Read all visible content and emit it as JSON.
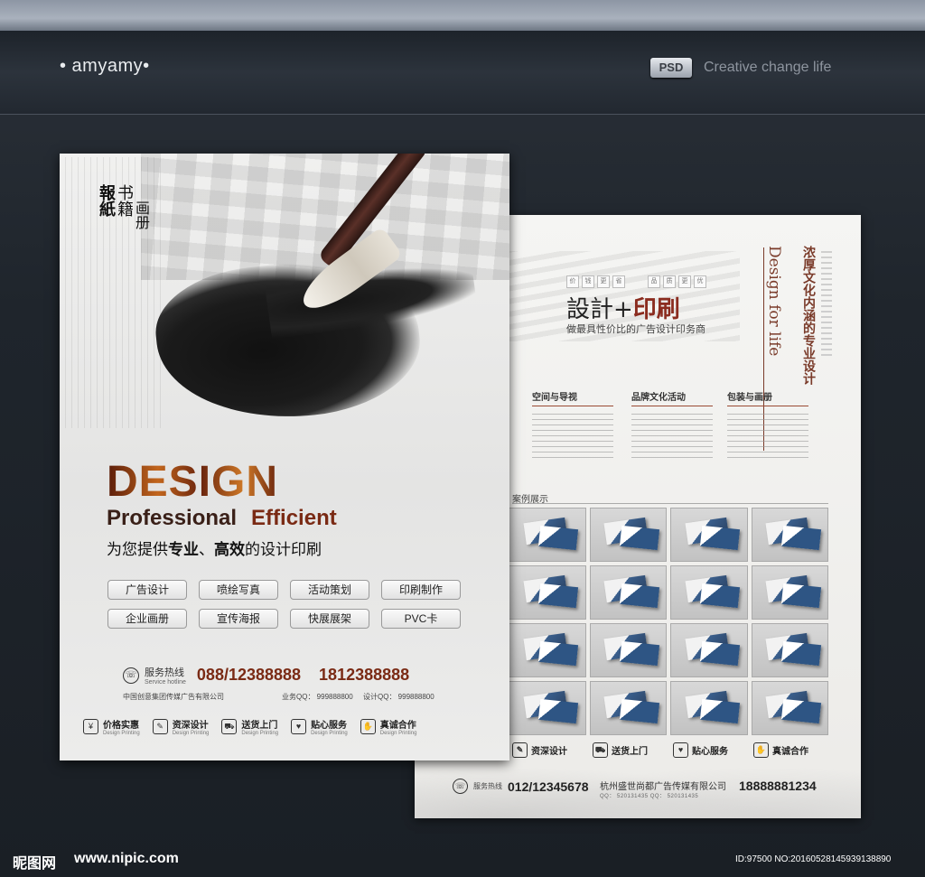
{
  "header": {
    "brand": "• amyamy•",
    "badge": "PSD",
    "tagline": "Creative change life"
  },
  "front": {
    "vertical_texts": [
      "報紙",
      "书籍",
      "画册"
    ],
    "headline": "DESIGN",
    "subheadline_1": "Professional",
    "subheadline_2": "Efficient",
    "tagline_a": "为您提供",
    "tagline_b": "专业",
    "tagline_c": "、",
    "tagline_d": "高效",
    "tagline_e": "的设计印刷",
    "services": [
      "广告设计",
      "喷绘写真",
      "活动策划",
      "印刷制作",
      "企业画册",
      "宣传海报",
      "快展展架",
      "PVC卡"
    ],
    "hotline_label": "服务热线",
    "hotline_label_en": "Service hotline",
    "phone_1": "088/12388888",
    "phone_2": "1812388888",
    "company": "中国创意集团传媒广告有限公司",
    "qq_1": "业务QQ： 999888800",
    "qq_2": "设计QQ： 999888800",
    "features": [
      {
        "cn": "价格实惠",
        "en": "Design Printing",
        "icon": "price-icon"
      },
      {
        "cn": "资深设计",
        "en": "Design Printing",
        "icon": "design-icon"
      },
      {
        "cn": "送货上门",
        "en": "Design Printing",
        "icon": "truck-icon"
      },
      {
        "cn": "贴心服务",
        "en": "Design Printing",
        "icon": "heart-icon"
      },
      {
        "cn": "真诚合作",
        "en": "Design Printing",
        "icon": "handshake-icon"
      }
    ]
  },
  "back": {
    "mini_chars": [
      "价",
      "钱",
      "更",
      "省",
      "品",
      "质",
      "更",
      "优"
    ],
    "title_a": "設計+",
    "title_b": "印刷",
    "subtitle": "做最具性价比的广告设计印务商",
    "vertical_en": "Design for life",
    "vertical_cn": "浓厚文化内涵的专业设计",
    "columns": [
      "空间与导视",
      "品牌文化活动",
      "包装与画册"
    ],
    "section_label": "案例展示",
    "features": [
      {
        "cn": "资深设计",
        "icon": "design-icon"
      },
      {
        "cn": "送货上门",
        "icon": "truck-icon"
      },
      {
        "cn": "贴心服务",
        "icon": "heart-icon"
      },
      {
        "cn": "真诚合作",
        "icon": "handshake-icon"
      }
    ],
    "hotline_label": "服务热线",
    "phone": "012/12345678",
    "company": "杭州盛世尚都广告传媒有限公司",
    "qq_text": "QQ： 520131435   QQ： 520131435",
    "mobile": "18888881234"
  },
  "footer": {
    "logo": "昵图网",
    "url": "www.nipic.com",
    "id": "ID:97500 NO:20160528145939138890"
  }
}
